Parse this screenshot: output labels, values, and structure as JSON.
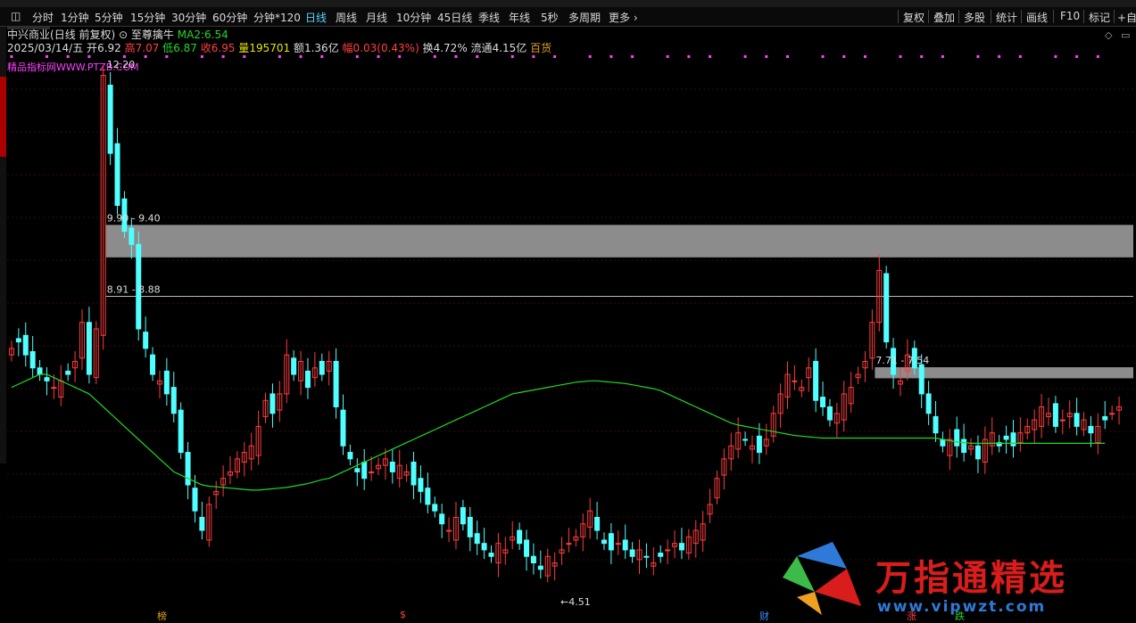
{
  "toolbar": {
    "items": [
      "分时",
      "1分钟",
      "5分钟",
      "15分钟",
      "30分钟",
      "60分钟",
      "分钟*120",
      "日线",
      "周线",
      "月线",
      "10分钟",
      "45日线",
      "季线",
      "年线",
      "5秒",
      "多周期",
      "更多"
    ],
    "right_items": [
      "复权",
      "叠加",
      "多股",
      "统计",
      "画线",
      "F10",
      "标记",
      "+自"
    ],
    "active": "日线"
  },
  "stock": {
    "name": "中兴商业",
    "mode": "(日线 前复权)",
    "indicator": "至尊擒牛",
    "ma_label": "MA2:",
    "ma_value": "6.54",
    "date": "2025/03/14/五",
    "open_label": "开",
    "open": "6.92",
    "high_label": "高",
    "high": "7.07",
    "low_label": "低",
    "low": "6.87",
    "close_label": "收",
    "close": "6.95",
    "volume_label": "量",
    "volume": "195701",
    "amount_label": "额",
    "amount": "1.36亿",
    "change_label": "幅",
    "change": "0.03(0.43%)",
    "turnover_label": "换",
    "turnover": "4.72%",
    "float_label": "流通",
    "float_cap": "4.15亿",
    "sector": "百货"
  },
  "site_tag": "精品指标网WWW.PTZB.COM",
  "annotations": {
    "high_price": "12.20",
    "low_price": "4.51",
    "zone1": "9.90 - 9.40",
    "zone2": "8.91 - 8.88",
    "zone3": "7.71 - 7.54"
  },
  "bottom_labels": [
    {
      "text": "榜",
      "color": "#e0a020"
    },
    {
      "text": "$",
      "color": "#ff4040"
    },
    {
      "text": "财",
      "color": "#3c8cff"
    },
    {
      "text": "涨",
      "color": "#ff4040"
    },
    {
      "text": "跌",
      "color": "#22d822"
    }
  ],
  "watermark": {
    "title": "万指通精选",
    "url": "www.vipwzt.com"
  },
  "chart_data": {
    "type": "candlestick",
    "indicator_line": "MA2",
    "ylim": [
      4.2,
      12.4
    ],
    "zones": [
      [
        9.4,
        9.9
      ],
      [
        8.88,
        8.91
      ],
      [
        7.54,
        7.71
      ]
    ],
    "closes": [
      8.0,
      8.1,
      7.9,
      7.7,
      7.6,
      7.5,
      7.4,
      7.5,
      7.6,
      7.8,
      8.4,
      7.6,
      8.3,
      12.2,
      11.0,
      10.2,
      9.8,
      9.6,
      8.3,
      8.0,
      7.6,
      7.5,
      7.3,
      7.0,
      6.4,
      5.9,
      5.5,
      5.2,
      5.6,
      5.8,
      6.0,
      6.1,
      6.3,
      6.4,
      6.5,
      6.8,
      7.2,
      7.0,
      7.3,
      7.9,
      7.6,
      7.8,
      7.4,
      7.7,
      7.6,
      7.8,
      7.1,
      6.5,
      6.3,
      6.1,
      6.0,
      6.1,
      6.2,
      6.3,
      6.1,
      6.2,
      6.1,
      5.9,
      5.8,
      5.6,
      5.5,
      5.3,
      5.2,
      5.4,
      5.3,
      5.1,
      5.0,
      4.9,
      4.8,
      5.0,
      4.9,
      5.1,
      5.0,
      4.8,
      4.7,
      4.6,
      4.8,
      4.7,
      4.9,
      5.0,
      5.1,
      5.3,
      5.5,
      5.2,
      5.0,
      4.9,
      5.0,
      4.9,
      4.8,
      4.9,
      4.8,
      4.7,
      4.8,
      4.9,
      5.0,
      4.9,
      5.1,
      5.2,
      5.3,
      5.6,
      6.0,
      6.3,
      6.5,
      6.7,
      6.6,
      6.5,
      6.4,
      6.6,
      7.0,
      7.3,
      7.6,
      7.5,
      7.4,
      7.7,
      7.2,
      7.1,
      6.9,
      7.0,
      7.3,
      7.4,
      7.6,
      7.8,
      8.4,
      9.2,
      8.1,
      7.6,
      7.5,
      7.9,
      7.7,
      7.3,
      7.0,
      6.7,
      6.5,
      6.6,
      6.5,
      6.4,
      6.5,
      6.3,
      6.6,
      6.7,
      6.5,
      6.6,
      6.5,
      6.7,
      6.8,
      6.9,
      7.1,
      7.0,
      6.8,
      6.9,
      7.0,
      6.8,
      6.9,
      6.7,
      6.8,
      6.9,
      7.0,
      7.1
    ],
    "ma": [
      7.4,
      7.45,
      7.5,
      7.55,
      7.6,
      7.6,
      7.55,
      7.5,
      7.45,
      7.4,
      7.35,
      7.3,
      7.2,
      7.1,
      7.0,
      6.9,
      6.8,
      6.7,
      6.6,
      6.5,
      6.4,
      6.3,
      6.2,
      6.1,
      6.05,
      6.0,
      5.95,
      5.9,
      5.88,
      5.87,
      5.86,
      5.85,
      5.84,
      5.83,
      5.82,
      5.82,
      5.83,
      5.84,
      5.85,
      5.86,
      5.88,
      5.9,
      5.92,
      5.95,
      5.98,
      6.0,
      6.05,
      6.1,
      6.15,
      6.2,
      6.25,
      6.3,
      6.35,
      6.4,
      6.45,
      6.5,
      6.55,
      6.6,
      6.65,
      6.7,
      6.75,
      6.8,
      6.85,
      6.9,
      6.95,
      7.0,
      7.05,
      7.1,
      7.15,
      7.2,
      7.25,
      7.3,
      7.32,
      7.34,
      7.36,
      7.38,
      7.4,
      7.42,
      7.44,
      7.46,
      7.48,
      7.49,
      7.5,
      7.5,
      7.49,
      7.48,
      7.47,
      7.46,
      7.44,
      7.42,
      7.4,
      7.38,
      7.35,
      7.3,
      7.25,
      7.2,
      7.15,
      7.1,
      7.05,
      7.0,
      6.95,
      6.9,
      6.85,
      6.82,
      6.8,
      6.78,
      6.76,
      6.74,
      6.72,
      6.7,
      6.68,
      6.66,
      6.65,
      6.64,
      6.63,
      6.62,
      6.62,
      6.62,
      6.62,
      6.62,
      6.62,
      6.62,
      6.62,
      6.62,
      6.62,
      6.62,
      6.62,
      6.62,
      6.62,
      6.62,
      6.62,
      6.62,
      6.6,
      6.58,
      6.56,
      6.55,
      6.54,
      6.54,
      6.54,
      6.54,
      6.54,
      6.54,
      6.54,
      6.54,
      6.54,
      6.54,
      6.54,
      6.54,
      6.54,
      6.54,
      6.54,
      6.54,
      6.54,
      6.54,
      6.54,
      6.54
    ]
  }
}
